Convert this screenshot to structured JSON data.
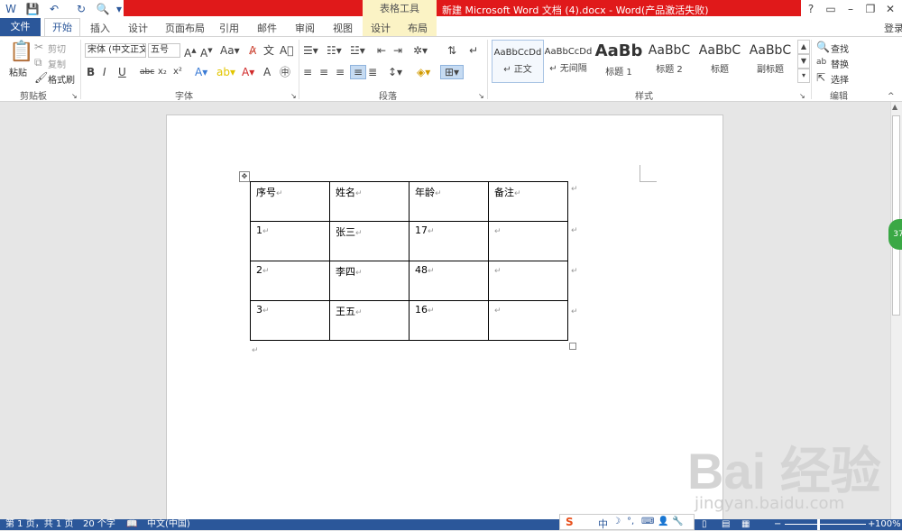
{
  "titlebar": {
    "title": "新建 Microsoft Word 文档 (4).docx -  Word(产品激活失败)",
    "table_tools": "表格工具",
    "help": "?",
    "login": "登录"
  },
  "tabs": {
    "file": "文件",
    "home": "开始",
    "insert": "插入",
    "design": "设计",
    "layout_page": "页面布局",
    "references": "引用",
    "mailings": "邮件",
    "review": "审阅",
    "view": "视图",
    "table_design": "设计",
    "table_layout": "布局"
  },
  "clipboard": {
    "paste": "粘贴",
    "cut": "剪切",
    "copy": "复制",
    "format_painter": "格式刷",
    "label": "剪贴板"
  },
  "font": {
    "name": "宋体 (中文正文)",
    "size": "五号",
    "bold": "B",
    "italic": "I",
    "underline": "U",
    "strike": "abc",
    "subscript": "x₂",
    "superscript": "x²",
    "label": "字体"
  },
  "paragraph": {
    "label": "段落"
  },
  "styles": {
    "label": "样式",
    "items": [
      {
        "preview": "AaBbCcDd",
        "name": "↵ 正文"
      },
      {
        "preview": "AaBbCcDd",
        "name": "↵ 无间隔"
      },
      {
        "preview": "AaBb",
        "name": "标题 1"
      },
      {
        "preview": "AaBbC",
        "name": "标题 2"
      },
      {
        "preview": "AaBbC",
        "name": "标题"
      },
      {
        "preview": "AaBbC",
        "name": "副标题"
      }
    ]
  },
  "editing": {
    "find": "查找",
    "replace": "替换",
    "select": "选择",
    "label": "编辑"
  },
  "table": {
    "headers": [
      "序号",
      "姓名",
      "年龄",
      "备注"
    ],
    "rows": [
      [
        "1",
        "张三",
        "17",
        ""
      ],
      [
        "2",
        "李四",
        "48",
        ""
      ],
      [
        "3",
        "王五",
        "16",
        ""
      ]
    ]
  },
  "statusbar": {
    "page": "第 1 页，共 1 页",
    "words": "20 个字",
    "language": "中文(中国)",
    "zoom": "100%"
  },
  "side_badge": "37",
  "watermark": {
    "logo": "Bai 经验",
    "url": "jingyan.baidu.com"
  }
}
